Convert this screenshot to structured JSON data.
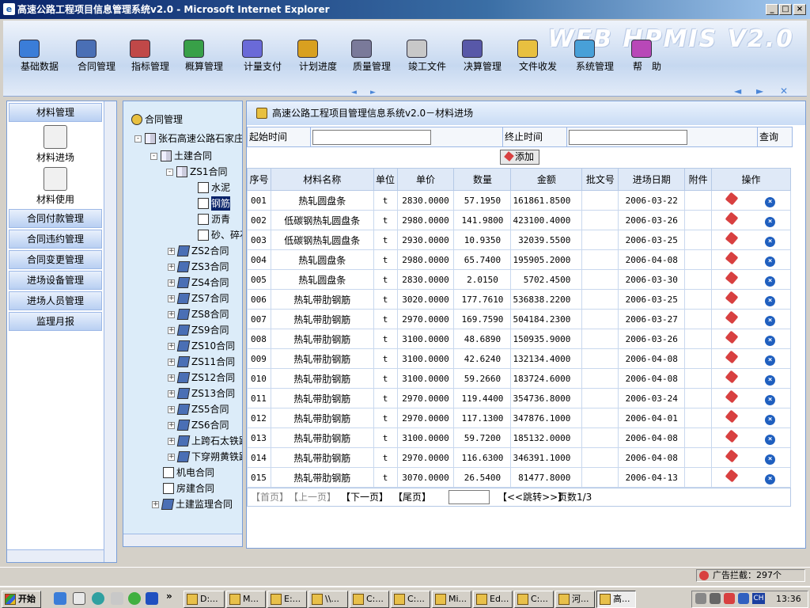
{
  "window": {
    "title": "高速公路工程项目信息管理系统v2.0 - Microsoft Internet Explorer",
    "min": "_",
    "max": "□",
    "close": "×"
  },
  "banner": {
    "watermark": "WEB HPMIS V2.0"
  },
  "topnav": [
    {
      "label": "基础数据",
      "icon": "database-icon",
      "color": "#3b7dd8"
    },
    {
      "label": "合同管理",
      "icon": "contract-icon",
      "color": "#4a6fb5"
    },
    {
      "label": "指标管理",
      "icon": "indicator-icon",
      "color": "#c04848"
    },
    {
      "label": "概算管理",
      "icon": "pie-chart-icon",
      "color": "#38a048"
    },
    {
      "label": "计量支付",
      "icon": "ruler-icon",
      "color": "#6a6ad8"
    },
    {
      "label": "计划进度",
      "icon": "bar-chart-icon",
      "color": "#d8a020"
    },
    {
      "label": "质量管理",
      "icon": "gear-icon",
      "color": "#7a7a9a"
    },
    {
      "label": "竣工文件",
      "icon": "document-icon",
      "color": "#c8c8c8"
    },
    {
      "label": "决算管理",
      "icon": "calculator-icon",
      "color": "#5858a8"
    },
    {
      "label": "文件收发",
      "icon": "mail-icon",
      "color": "#e8c040"
    },
    {
      "label": "系统管理",
      "icon": "computer-icon",
      "color": "#48a0d8"
    },
    {
      "label": "帮　助",
      "icon": "help-icon",
      "color": "#b848b8"
    }
  ],
  "banner_nav": {
    "prev": "◄",
    "next": "►",
    "back": "◄",
    "fwd": "►",
    "close": "✕"
  },
  "left": {
    "material_header": "材料管理",
    "material_in": "材料进场",
    "material_use": "材料使用",
    "menus": [
      "合同付款管理",
      "合同违约管理",
      "合同变更管理",
      "进场设备管理",
      "进场人员管理",
      "监理月报"
    ]
  },
  "tree": {
    "root": "合同管理",
    "project": "张石高速公路石家庄",
    "civil": "土建合同",
    "zs1": "ZS1合同",
    "zs1_children": [
      "水泥",
      "钢筋",
      "沥青",
      "砂、碎石"
    ],
    "contracts": [
      "ZS2合同",
      "ZS3合同",
      "ZS4合同",
      "ZS7合同",
      "ZS8合同",
      "ZS9合同",
      "ZS10合同",
      "ZS11合同",
      "ZS12合同",
      "ZS13合同",
      "ZS5合同",
      "ZS6合同",
      "上跨石太铁路",
      "下穿朔黄铁路"
    ],
    "mech": "机电合同",
    "house": "房建合同",
    "supervise": "土建监理合同",
    "plus": "+",
    "minus": "-"
  },
  "main": {
    "title": "高速公路工程项目管理信息系统v2.0－材料进场",
    "start_label": "起始时间",
    "end_label": "终止时间",
    "query": "查询",
    "add": "添加",
    "columns": [
      "序号",
      "材料名称",
      "单位",
      "单价",
      "数量",
      "金额",
      "批文号",
      "进场日期",
      "附件",
      "操作"
    ],
    "rows": [
      [
        "001",
        "热轧圆盘条",
        "t",
        "2830.0000",
        "57.1950",
        "161861.8500",
        "",
        "2006-03-22"
      ],
      [
        "002",
        "低碳钢热轧圆盘条",
        "t",
        "2980.0000",
        "141.9800",
        "423100.4000",
        "",
        "2006-03-26"
      ],
      [
        "003",
        "低碳钢热轧圆盘条",
        "t",
        "2930.0000",
        "10.9350",
        "32039.5500",
        "",
        "2006-03-25"
      ],
      [
        "004",
        "热轧圆盘条",
        "t",
        "2980.0000",
        "65.7400",
        "195905.2000",
        "",
        "2006-04-08"
      ],
      [
        "005",
        "热轧圆盘条",
        "t",
        "2830.0000",
        "2.0150",
        "5702.4500",
        "",
        "2006-03-30"
      ],
      [
        "006",
        "热轧带肋钢筋",
        "t",
        "3020.0000",
        "177.7610",
        "536838.2200",
        "",
        "2006-03-25"
      ],
      [
        "007",
        "热轧带肋钢筋",
        "t",
        "2970.0000",
        "169.7590",
        "504184.2300",
        "",
        "2006-03-27"
      ],
      [
        "008",
        "热轧带肋钢筋",
        "t",
        "3100.0000",
        "48.6890",
        "150935.9000",
        "",
        "2006-03-26"
      ],
      [
        "009",
        "热轧带肋钢筋",
        "t",
        "3100.0000",
        "42.6240",
        "132134.4000",
        "",
        "2006-04-08"
      ],
      [
        "010",
        "热轧带肋钢筋",
        "t",
        "3100.0000",
        "59.2660",
        "183724.6000",
        "",
        "2006-04-08"
      ],
      [
        "011",
        "热轧带肋钢筋",
        "t",
        "2970.0000",
        "119.4400",
        "354736.8000",
        "",
        "2006-03-24"
      ],
      [
        "012",
        "热轧带肋钢筋",
        "t",
        "2970.0000",
        "117.1300",
        "347876.1000",
        "",
        "2006-04-01"
      ],
      [
        "013",
        "热轧带肋钢筋",
        "t",
        "3100.0000",
        "59.7200",
        "185132.0000",
        "",
        "2006-04-08"
      ],
      [
        "014",
        "热轧带肋钢筋",
        "t",
        "2970.0000",
        "116.6300",
        "346391.1000",
        "",
        "2006-04-08"
      ],
      [
        "015",
        "热轧带肋钢筋",
        "t",
        "3070.0000",
        "26.5400",
        "81477.8000",
        "",
        "2006-04-13"
      ]
    ],
    "pager": {
      "first": "【首页】",
      "prev": "【上一页】",
      "next": "【下一页】",
      "last": "【尾页】",
      "jump": "【<<跳转>>】",
      "pages": "页数1/3"
    }
  },
  "status": {
    "popup": "广告拦截：297个"
  },
  "taskbar": {
    "start": "开始",
    "tasks": [
      "D:...",
      "M...",
      "E:...",
      "\\\\...",
      "C:...",
      "C:...",
      "Mi...",
      "Ed...",
      "C:...",
      "河...",
      "高..."
    ],
    "lang": "CH",
    "clock": "13:36",
    "more": "»"
  }
}
